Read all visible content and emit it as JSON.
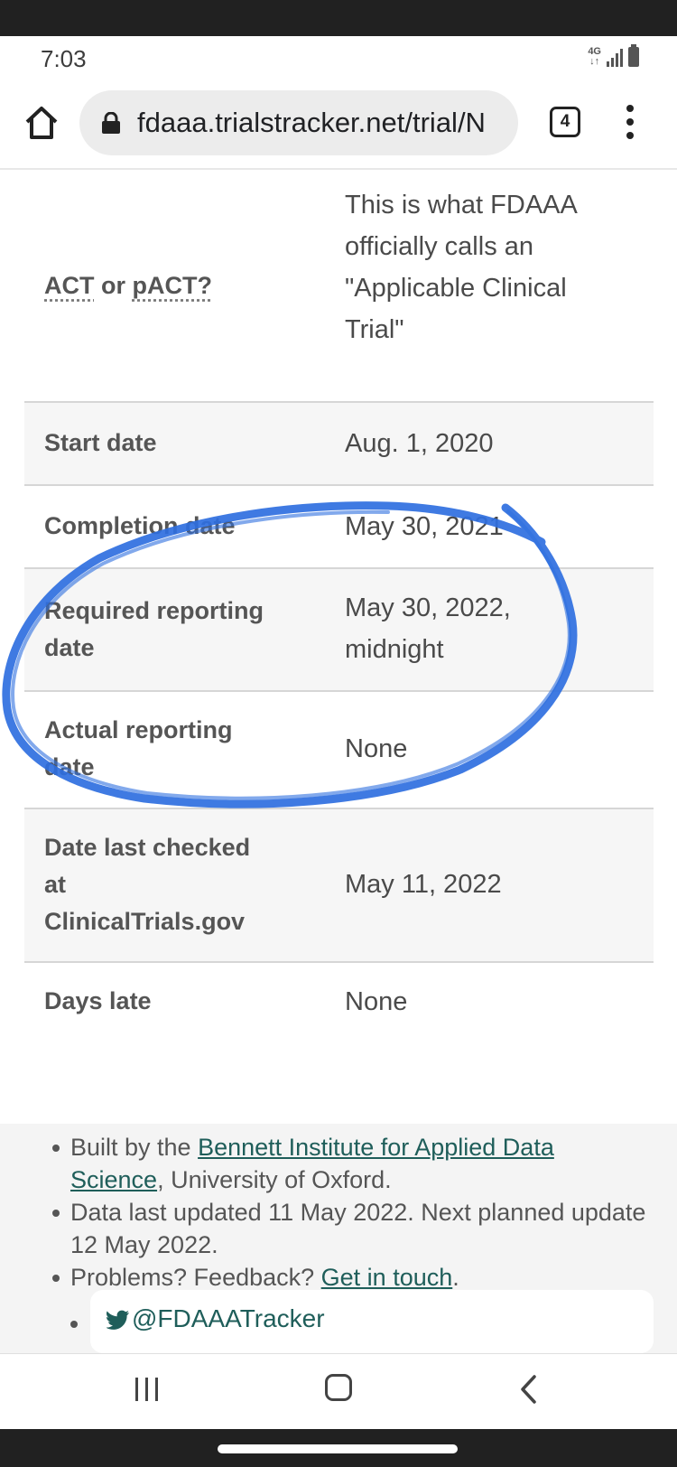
{
  "status_bar": {
    "time": "7:03",
    "network": "4G"
  },
  "browser": {
    "url": "fdaaa.trialstracker.net/trial/N",
    "tab_count": "4"
  },
  "details": {
    "act_label_a": "ACT",
    "act_label_or": " or ",
    "act_label_b": "pACT?",
    "act_value": "This is what FDAAA officially calls an \"Applicable Clinical Trial\"",
    "start_label": "Start date",
    "start_value": "Aug. 1, 2020",
    "completion_label": "Completion date",
    "completion_value": "May 30, 2021",
    "required_label": "Required reporting date",
    "required_value": "May 30, 2022, midnight",
    "actual_label": "Actual reporting date",
    "actual_value": "None",
    "checked_label": "Date last checked at ClinicalTrials.gov",
    "checked_value": "May 11, 2022",
    "late_label": "Days late",
    "late_value": "None"
  },
  "footer": {
    "built_prefix": "Built by the ",
    "built_link": "Bennett Institute for Applied Data Science",
    "built_suffix": ", University of Oxford.",
    "updated_text": "Data last updated 11 May 2022. Next planned update 12 May 2022.",
    "problems_prefix": "Problems? Feedback? ",
    "problems_link": "Get in touch",
    "problems_suffix": ".",
    "twitter_handle": "@FDAAATracker"
  },
  "colors": {
    "link": "#1f5e5a",
    "annotation": "#2f6fe0"
  }
}
